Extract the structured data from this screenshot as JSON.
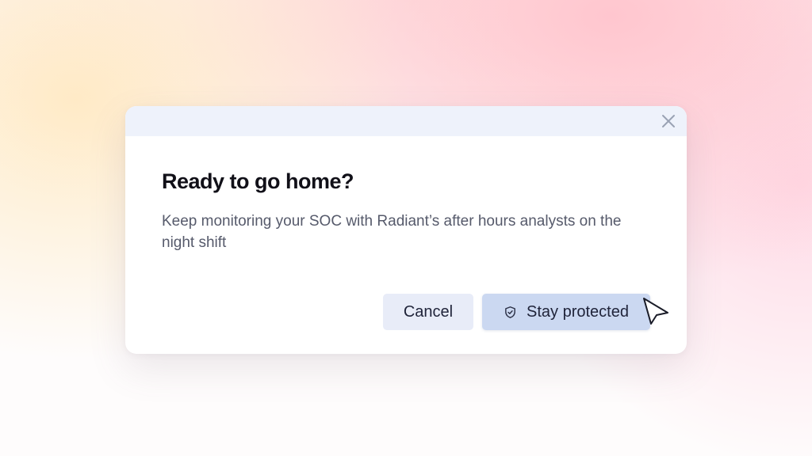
{
  "dialog": {
    "title": "Ready to go home?",
    "description": "Keep monitoring your SOC with Radiant’s after hours analysts on the night shift",
    "close_icon": "close-icon",
    "buttons": {
      "cancel_label": "Cancel",
      "primary_label": "Stay protected",
      "primary_icon": "shield-check-icon"
    }
  },
  "cursor_icon": "pointer-cursor-icon",
  "colors": {
    "header_bg": "#eef2fb",
    "cancel_bg": "#e8ecf8",
    "primary_bg": "#cbd8f1",
    "title": "#111018",
    "body_text": "#565a6b"
  }
}
